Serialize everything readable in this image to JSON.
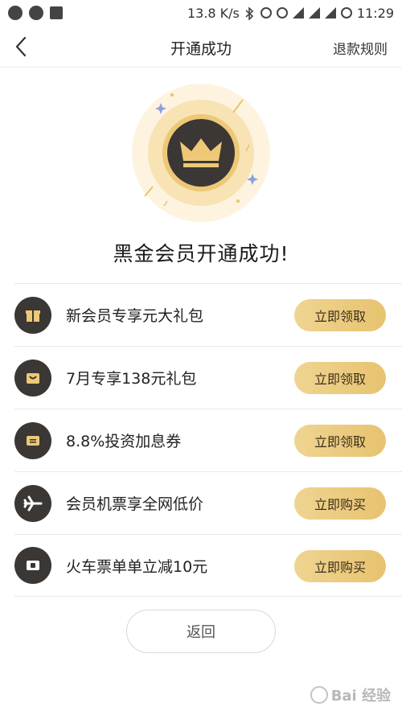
{
  "status_bar": {
    "speed": "13.8 K/s",
    "time": "11:29"
  },
  "nav": {
    "title": "开通成功",
    "right_link": "退款规则"
  },
  "headline": "黑金会员开通成功!",
  "benefits": [
    {
      "label": "新会员专享元大礼包",
      "button": "立即领取",
      "icon": "gift-icon"
    },
    {
      "label": "7月专享138元礼包",
      "button": "立即领取",
      "icon": "package-icon"
    },
    {
      "label": "8.8%投资加息券",
      "button": "立即领取",
      "icon": "coupon-icon"
    },
    {
      "label": "会员机票享全网低价",
      "button": "立即购买",
      "icon": "airplane-icon"
    },
    {
      "label": "火车票单单立减10元",
      "button": "立即购买",
      "icon": "train-ticket-icon"
    }
  ],
  "back_button": "返回",
  "watermark": "Bai 经验",
  "colors": {
    "gold": "#e7c36f",
    "dark_icon": "#3a3734"
  }
}
